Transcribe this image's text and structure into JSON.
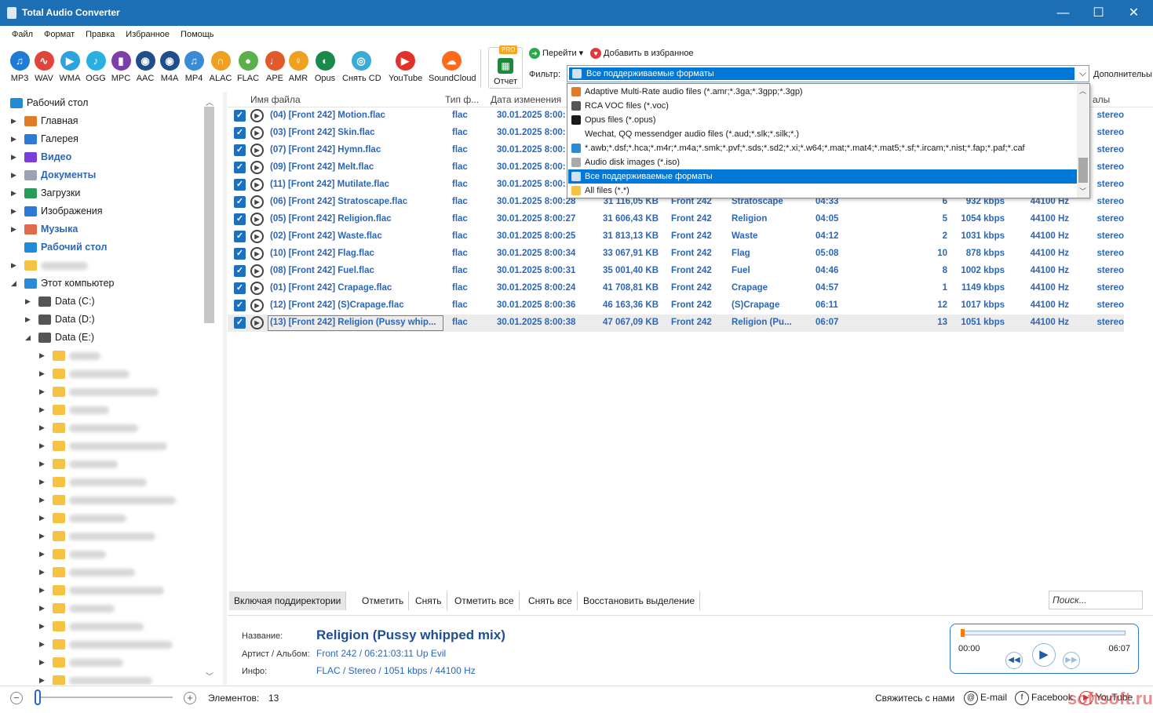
{
  "window": {
    "title": "Total Audio Converter",
    "min": "—",
    "max": "☐",
    "close": "✕"
  },
  "menu": [
    "Файл",
    "Формат",
    "Правка",
    "Избранное",
    "Помощь"
  ],
  "formats": [
    {
      "label": "MP3",
      "color": "#1f7bd6",
      "glyph": "♫"
    },
    {
      "label": "WAV",
      "color": "#e0443a",
      "glyph": "∿"
    },
    {
      "label": "WMA",
      "color": "#2aa3e0",
      "glyph": "▶"
    },
    {
      "label": "OGG",
      "color": "#2ab0e0",
      "glyph": "♪"
    },
    {
      "label": "MPC",
      "color": "#7b3fa6",
      "glyph": "▮"
    },
    {
      "label": "AAC",
      "color": "#1f4f8a",
      "glyph": "◉"
    },
    {
      "label": "M4A",
      "color": "#1f4f8a",
      "glyph": "◉"
    },
    {
      "label": "MP4",
      "color": "#3a8ad6",
      "glyph": "♫"
    },
    {
      "label": "ALAC",
      "color": "#f0a020",
      "glyph": "∩"
    },
    {
      "label": "FLAC",
      "color": "#5ab04a",
      "glyph": "●"
    },
    {
      "label": "APE",
      "color": "#e05a2a",
      "glyph": "♩"
    },
    {
      "label": "AMR",
      "color": "#f0a020",
      "glyph": "♀"
    },
    {
      "label": "Opus",
      "color": "#1a8a4a",
      "glyph": "◐"
    },
    {
      "label": "Снять CD",
      "color": "#3aaad6",
      "glyph": "◎"
    },
    {
      "label": "YouTube",
      "color": "#e0322a",
      "glyph": "▶"
    },
    {
      "label": "SoundCloud",
      "color": "#ff6a1a",
      "glyph": "☁"
    }
  ],
  "report": {
    "badge": "PRO",
    "label": "Отчет"
  },
  "goto": "Перейти ▾",
  "favorite": "Добавить в избранное",
  "filter": {
    "label": "Фильтр:",
    "value": "Все поддерживаемые форматы"
  },
  "extra": "Дополнительы",
  "tree": [
    {
      "label": "Рабочий стол",
      "level": 0,
      "exp": "",
      "icon": "#1f8ad6",
      "style": ""
    },
    {
      "label": "Главная",
      "level": 1,
      "exp": "▶",
      "icon": "#e07b2a",
      "style": ""
    },
    {
      "label": "Галерея",
      "level": 1,
      "exp": "▶",
      "icon": "#2a7ad6",
      "style": ""
    },
    {
      "label": "Видео",
      "level": 1,
      "exp": "▶",
      "icon": "#7b3fd6",
      "style": "blue"
    },
    {
      "label": "Документы",
      "level": 1,
      "exp": "▶",
      "icon": "#9aa4b0",
      "style": "blue"
    },
    {
      "label": "Загрузки",
      "level": 1,
      "exp": "▶",
      "icon": "#2a9a5a",
      "style": ""
    },
    {
      "label": "Изображения",
      "level": 1,
      "exp": "▶",
      "icon": "#2a7ad6",
      "style": ""
    },
    {
      "label": "Музыка",
      "level": 1,
      "exp": "▶",
      "icon": "#e06a4a",
      "style": "blue"
    },
    {
      "label": "Рабочий стол",
      "level": 1,
      "exp": "",
      "icon": "#1f8ad6",
      "style": "blue"
    },
    {
      "label": "",
      "level": 1,
      "exp": "▶",
      "icon": "#f5c242",
      "style": "blur"
    },
    {
      "label": "Этот компьютер",
      "level": 1,
      "exp": "◢",
      "icon": "#2a8ad6",
      "style": ""
    },
    {
      "label": "Data (C:)",
      "level": 2,
      "exp": "▶",
      "icon": "#555",
      "style": ""
    },
    {
      "label": "Data (D:)",
      "level": 2,
      "exp": "▶",
      "icon": "#555",
      "style": ""
    },
    {
      "label": "Data (E:)",
      "level": 2,
      "exp": "◢",
      "icon": "#555",
      "style": ""
    }
  ],
  "tree_blurred_count": 19,
  "columns": [
    "Имя файла",
    "Тип ф...",
    "Дата изменения",
    "алы"
  ],
  "rows": [
    {
      "name": "(04) [Front 242] Motion.flac",
      "type": "flac",
      "date": "30.01.2025 8:00:",
      "size": "",
      "album": "",
      "title": "",
      "dur": "",
      "track": "",
      "bitrate": "",
      "hz": "",
      "ch": "stereo"
    },
    {
      "name": "(03) [Front 242] Skin.flac",
      "type": "flac",
      "date": "30.01.2025 8:00:",
      "size": "",
      "album": "",
      "title": "",
      "dur": "",
      "track": "",
      "bitrate": "",
      "hz": "",
      "ch": "stereo"
    },
    {
      "name": "(07) [Front 242] Hymn.flac",
      "type": "flac",
      "date": "30.01.2025 8:00:",
      "size": "",
      "album": "",
      "title": "",
      "dur": "",
      "track": "",
      "bitrate": "",
      "hz": "",
      "ch": "stereo"
    },
    {
      "name": "(09) [Front 242] Melt.flac",
      "type": "flac",
      "date": "30.01.2025 8:00:",
      "size": "",
      "album": "",
      "title": "",
      "dur": "",
      "track": "",
      "bitrate": "",
      "hz": "",
      "ch": "stereo"
    },
    {
      "name": "(11) [Front 242] Mutilate.flac",
      "type": "flac",
      "date": "30.01.2025 8:00:",
      "size": "",
      "album": "",
      "title": "",
      "dur": "",
      "track": "",
      "bitrate": "",
      "hz": "",
      "ch": "stereo"
    },
    {
      "name": "(06) [Front 242] Stratoscape.flac",
      "type": "flac",
      "date": "30.01.2025 8:00:28",
      "size": "31 116,05 KB",
      "album": "Front 242",
      "title": "Stratoscape",
      "dur": "04:33",
      "track": "6",
      "bitrate": "932 kbps",
      "hz": "44100 Hz",
      "ch": "stereo"
    },
    {
      "name": "(05) [Front 242] Religion.flac",
      "type": "flac",
      "date": "30.01.2025 8:00:27",
      "size": "31 606,43 KB",
      "album": "Front 242",
      "title": "Religion",
      "dur": "04:05",
      "track": "5",
      "bitrate": "1054 kbps",
      "hz": "44100 Hz",
      "ch": "stereo"
    },
    {
      "name": "(02) [Front 242] Waste.flac",
      "type": "flac",
      "date": "30.01.2025 8:00:25",
      "size": "31 813,13 KB",
      "album": "Front 242",
      "title": "Waste",
      "dur": "04:12",
      "track": "2",
      "bitrate": "1031 kbps",
      "hz": "44100 Hz",
      "ch": "stereo"
    },
    {
      "name": "(10) [Front 242] Flag.flac",
      "type": "flac",
      "date": "30.01.2025 8:00:34",
      "size": "33 067,91 KB",
      "album": "Front 242",
      "title": "Flag",
      "dur": "05:08",
      "track": "10",
      "bitrate": "878 kbps",
      "hz": "44100 Hz",
      "ch": "stereo"
    },
    {
      "name": "(08) [Front 242] Fuel.flac",
      "type": "flac",
      "date": "30.01.2025 8:00:31",
      "size": "35 001,40 KB",
      "album": "Front 242",
      "title": "Fuel",
      "dur": "04:46",
      "track": "8",
      "bitrate": "1002 kbps",
      "hz": "44100 Hz",
      "ch": "stereo"
    },
    {
      "name": "(01) [Front 242] Crapage.flac",
      "type": "flac",
      "date": "30.01.2025 8:00:24",
      "size": "41 708,81 KB",
      "album": "Front 242",
      "title": "Crapage",
      "dur": "04:57",
      "track": "1",
      "bitrate": "1149 kbps",
      "hz": "44100 Hz",
      "ch": "stereo"
    },
    {
      "name": "(12) [Front 242] (S)Crapage.flac",
      "type": "flac",
      "date": "30.01.2025 8:00:36",
      "size": "46 163,36 KB",
      "album": "Front 242",
      "title": "(S)Crapage",
      "dur": "06:11",
      "track": "12",
      "bitrate": "1017 kbps",
      "hz": "44100 Hz",
      "ch": "stereo"
    },
    {
      "name": "(13) [Front 242] Religion (Pussy whip...",
      "type": "flac",
      "date": "30.01.2025 8:00:38",
      "size": "47 067,09 KB",
      "album": "Front 242",
      "title": "Religion (Pu...",
      "dur": "06:07",
      "track": "13",
      "bitrate": "1051 kbps",
      "hz": "44100 Hz",
      "ch": "stereo",
      "selected": true
    }
  ],
  "dropdown": [
    {
      "label": "Adaptive Multi-Rate audio files (*.amr;*.3ga;*.3gpp;*.3gp)",
      "icon": "#e07b2a"
    },
    {
      "label": "RCA VOC files (*.voc)",
      "icon": "#555"
    },
    {
      "label": "Opus files (*.opus)",
      "icon": "#1a1a1a"
    },
    {
      "label": "Wechat, QQ messendger audio files (*.aud;*.slk;*.silk;*.)",
      "icon": ""
    },
    {
      "label": "*.awb;*.dsf;*.hca;*.m4r;*.m4a;*.smk;*.pvf;*.sds;*.sd2;*.xi;*.w64;*.mat;*.mat4;*.mat5;*.sf;*.ircam;*.nist;*.fap;*.paf;*.caf",
      "icon": "#2a8ad6"
    },
    {
      "label": "Audio disk images (*.iso)",
      "icon": "#aaa"
    },
    {
      "label": "Все поддерживаемые форматы",
      "icon": "#cfe1f5",
      "selected": true
    },
    {
      "label": "All files (*.*)",
      "icon": "#f5c242"
    }
  ],
  "actions": [
    "Включая поддиректории",
    "Отметить",
    "Снять",
    "Отметить все",
    "Снять все",
    "Восстановить выделение"
  ],
  "search_placeholder": "Поиск...",
  "info": {
    "name_label": "Название:",
    "name": "Religion (Pussy whipped mix)",
    "artist_label": "Артист / Альбом:",
    "artist": "Front 242 / 06:21:03:11 Up Evil",
    "info_label": "Инфо:",
    "info": "FLAC / Stereo / 1051 kbps / 44100 Hz"
  },
  "player": {
    "start": "00:00",
    "end": "06:07",
    "progress": 0.0
  },
  "status": {
    "items_label": "Элементов:",
    "items": "13",
    "contact": "Свяжитесь с нами",
    "email": "E-mail",
    "facebook": "Facebook",
    "youtube": "YouTube"
  },
  "watermark": "softsoft.ru"
}
